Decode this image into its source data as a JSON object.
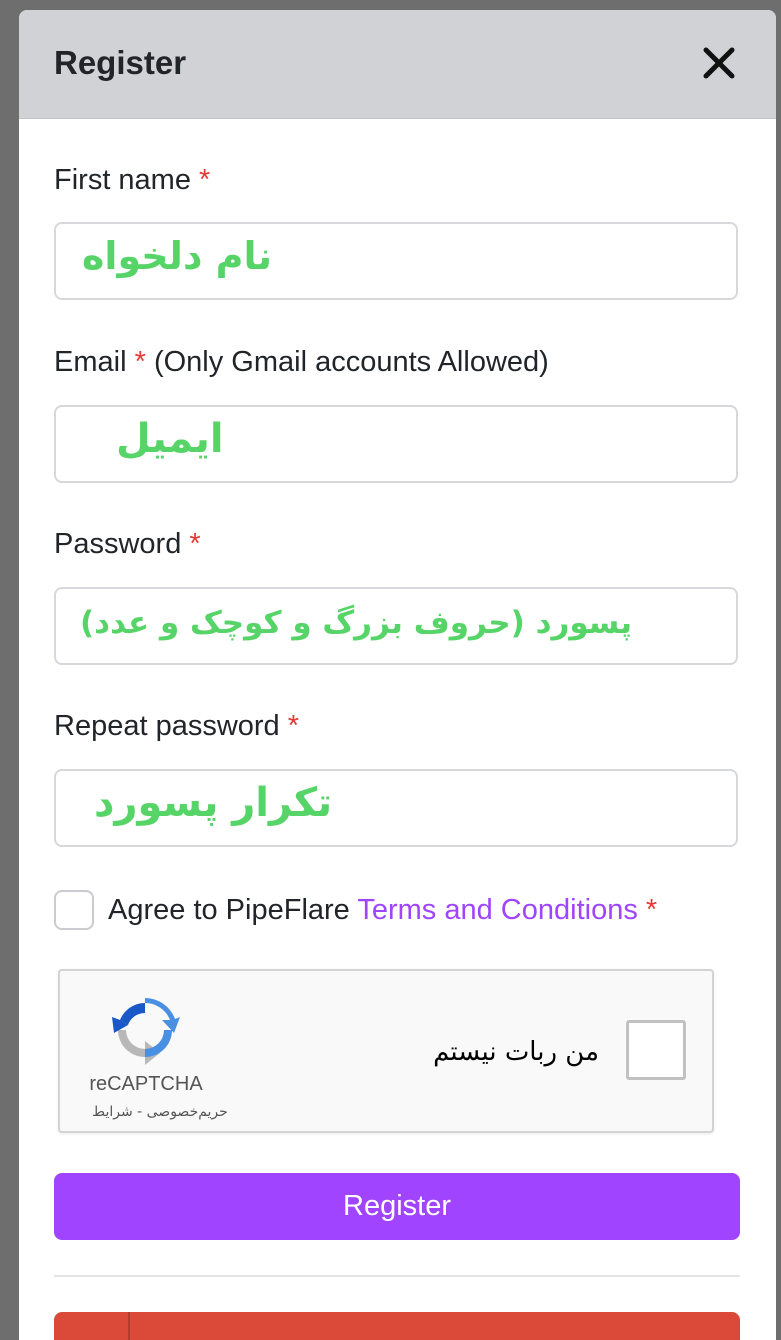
{
  "modal": {
    "title": "Register",
    "close_icon": "close-icon"
  },
  "fields": {
    "first_name": {
      "label": "First name",
      "required_mark": "*",
      "overlay_text": "نام دلخواه"
    },
    "email": {
      "label": "Email",
      "required_mark": "*",
      "note": "(Only Gmail accounts Allowed)",
      "overlay_text": "ایمیل"
    },
    "password": {
      "label": "Password",
      "required_mark": "*",
      "overlay_text": "پسورد (حروف بزرگ و کوچک و عدد)"
    },
    "repeat_password": {
      "label": "Repeat password",
      "required_mark": "*",
      "overlay_text": "تکرار پسورد"
    }
  },
  "agree": {
    "text": "Agree to PipeFlare",
    "link_text": "Terms and Conditions",
    "required_mark": "*"
  },
  "captcha": {
    "label": "من ربات نیستم",
    "brand": "reCAPTCHA",
    "links": "حریم‌خصوصی - شرایط",
    "icon": "recaptcha-icon"
  },
  "register_button": {
    "label": "Register"
  },
  "colors": {
    "accent": "#a044ff",
    "required": "#e53935",
    "overlay_green": "#57d468",
    "google_red": "#db4a39",
    "header_bg": "#d1d2d6"
  }
}
